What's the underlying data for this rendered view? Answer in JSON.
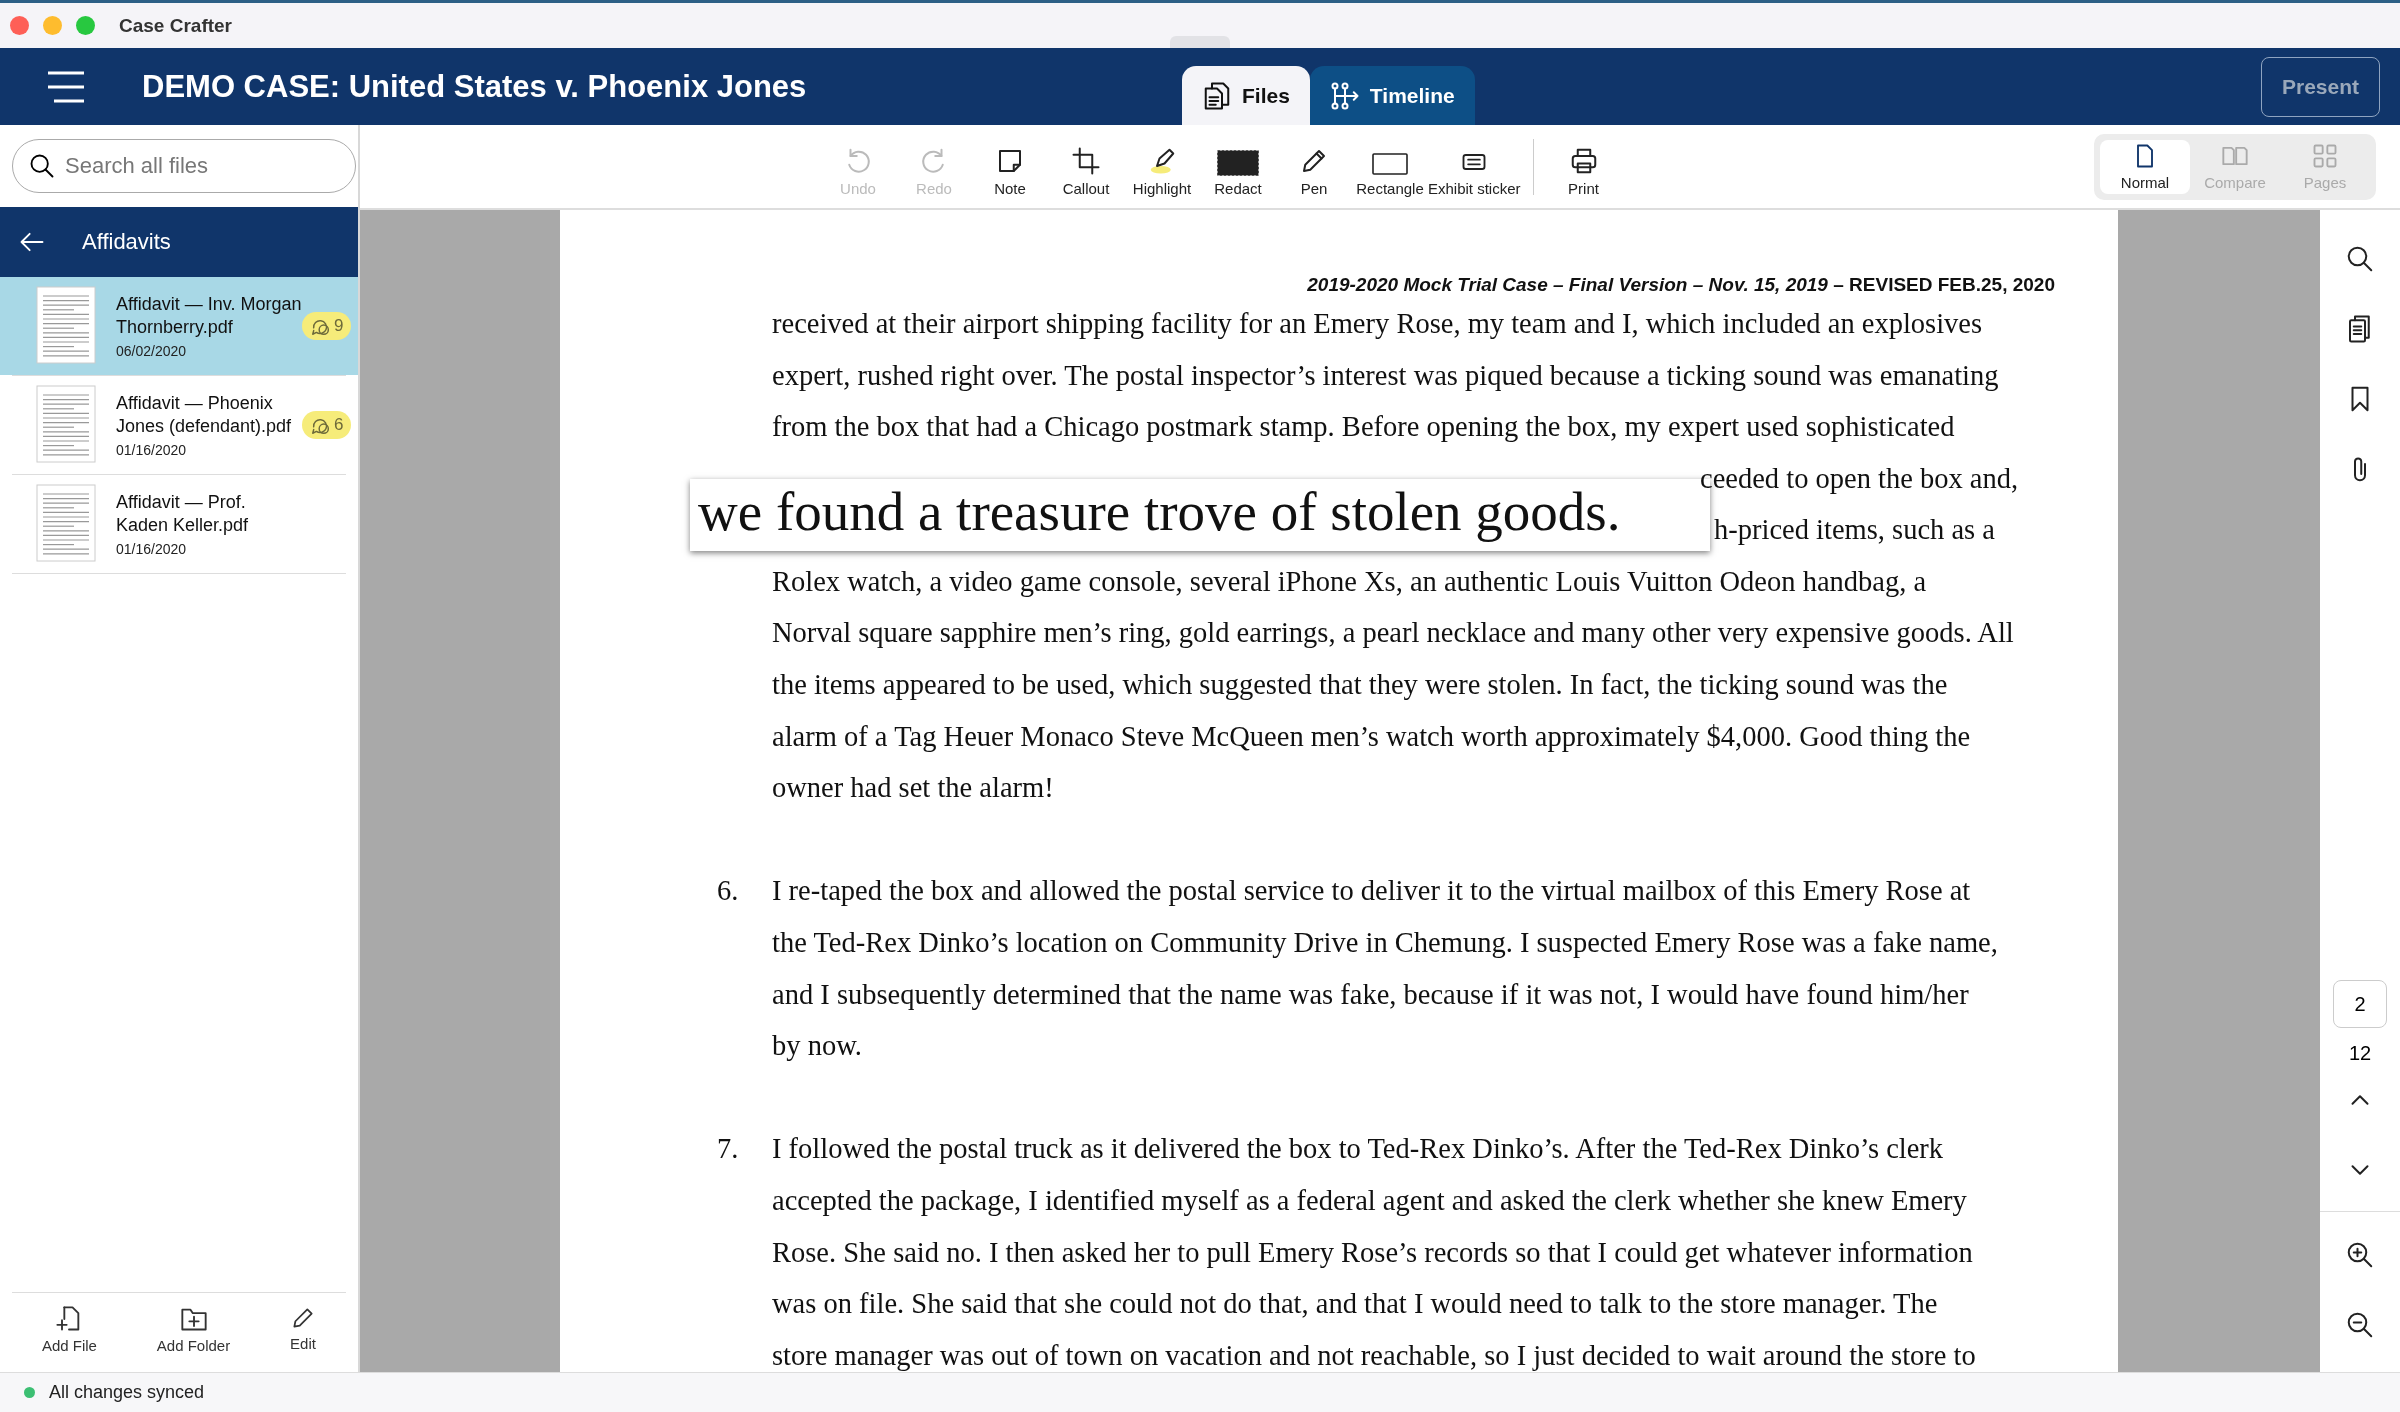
{
  "window": {
    "title": "Case Crafter"
  },
  "header": {
    "case_title": "DEMO CASE: United States v. Phoenix Jones",
    "tabs": [
      {
        "label": "Files",
        "kind": "files",
        "selected": true
      },
      {
        "label": "Timeline",
        "kind": "timeline",
        "selected": false
      }
    ],
    "present_button": "Present"
  },
  "search": {
    "placeholder": "Search all files"
  },
  "toolbar": [
    {
      "label": "Undo",
      "kind": "undo",
      "disabled": true
    },
    {
      "label": "Redo",
      "kind": "redo",
      "disabled": true
    },
    {
      "label": "Note",
      "kind": "note",
      "disabled": false
    },
    {
      "label": "Callout",
      "kind": "callout",
      "disabled": false
    },
    {
      "label": "Highlight",
      "kind": "highlight",
      "disabled": false
    },
    {
      "label": "Redact",
      "kind": "redact",
      "disabled": false
    },
    {
      "label": "Pen",
      "kind": "pen",
      "disabled": false
    },
    {
      "label": "Rectangle",
      "kind": "rectangle",
      "disabled": false
    },
    {
      "label": "Exhibit sticker",
      "kind": "sticker",
      "disabled": false
    },
    {
      "label": "Print",
      "kind": "print",
      "disabled": false
    }
  ],
  "view_modes": [
    {
      "label": "Normal",
      "kind": "normal",
      "selected": true
    },
    {
      "label": "Compare",
      "kind": "compare",
      "selected": false
    },
    {
      "label": "Pages",
      "kind": "pages",
      "selected": false
    }
  ],
  "sidebar": {
    "folder": "Affidavits",
    "files": [
      {
        "name": "Affidavit — Inv. Morgan Thornberry.pdf",
        "date": "06/02/2020",
        "comments": "9",
        "selected": true
      },
      {
        "name": "Affidavit — Phoenix Jones (defendant).pdf",
        "date": "01/16/2020",
        "comments": "6",
        "selected": false
      },
      {
        "name": "Affidavit — Prof. Kaden Keller.pdf",
        "date": "01/16/2020",
        "selected": false
      }
    ],
    "actions": [
      {
        "label": "Add File",
        "kind": "add-file"
      },
      {
        "label": "Add Folder",
        "kind": "add-folder"
      },
      {
        "label": "Edit",
        "kind": "edit"
      }
    ]
  },
  "document": {
    "page_header": "*2019-2020 Mock Trial Case – Final Version – Nov. 15, 2019* – REVISED FEB.25, 2020",
    "blocks": [
      {
        "kind": "text",
        "lines": [
          "received at their airport shipping facility for an Emery Rose, my team and I, which included an explosives",
          "expert, rushed right over. The postal inspector’s interest was piqued because a ticking sound was emanating",
          "from the box that had a Chicago postmark stamp. Before opening the box, my expert used sophisticated"
        ]
      },
      {
        "kind": "callout",
        "text": "we found a treasure trove of stolen goods.",
        "beside": [
          "ceeded to open the box and,",
          "h-priced items, such as a"
        ]
      },
      {
        "kind": "text",
        "lines": [
          "Rolex watch, a video game console, several iPhone Xs, an authentic Louis Vuitton Odeon handbag, a",
          "Norval square sapphire men’s ring, gold earrings, a pearl necklace and many other very expensive goods. All",
          "the items appeared to be used, which suggested that they were stolen. In fact, the ticking sound was the",
          "alarm of a Tag Heuer Monaco Steve McQueen men’s watch worth approximately $4,000. Good thing the",
          "owner had set the alarm!"
        ]
      },
      {
        "kind": "numbered",
        "number": "6.",
        "lines": [
          "I re-taped the box and allowed the postal service to deliver it to the virtual mailbox of this Emery Rose at",
          "the Ted-Rex Dinko’s location on Community Drive in Chemung. I suspected Emery Rose was a fake name,",
          "and I subsequently determined that the name was fake, because if it was not, I would have found him/her",
          "by now."
        ]
      },
      {
        "kind": "numbered",
        "number": "7.",
        "lines": [
          "I followed the postal truck as it delivered the box to Ted-Rex Dinko’s. After the Ted-Rex Dinko’s clerk",
          "accepted the package, I identified myself as a federal agent and asked the clerk whether she knew Emery",
          "Rose. She said no. I then asked her to pull Emery Rose’s records so that I could get whatever information",
          "was on file. She said that she could not do that, and that I would need to talk to the store manager. The",
          "store manager was out of town on vacation and not reachable, so I just decided to wait around the store to"
        ]
      }
    ]
  },
  "page_nav": {
    "current": "2",
    "total": "12"
  },
  "status_bar": {
    "text": "All changes synced"
  }
}
